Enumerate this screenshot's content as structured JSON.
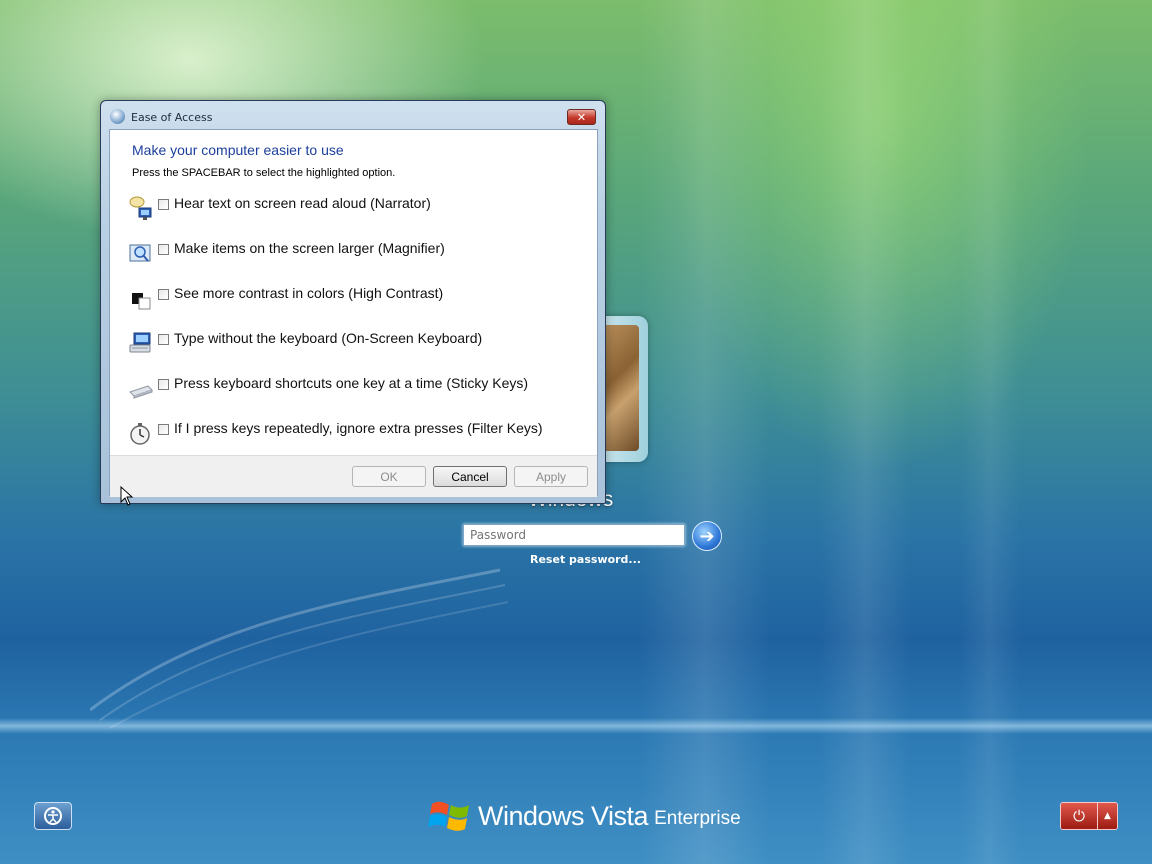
{
  "dialog": {
    "title": "Ease of Access",
    "heading": "Make your computer easier to use",
    "subtext": "Press the SPACEBAR to select the highlighted option.",
    "options": [
      {
        "label": "Hear text on screen read aloud (Narrator)",
        "icon": "narrator-icon",
        "checked": false
      },
      {
        "label": "Make items on the screen larger (Magnifier)",
        "icon": "magnifier-icon",
        "checked": false
      },
      {
        "label": "See more contrast in colors (High Contrast)",
        "icon": "high-contrast-icon",
        "checked": false
      },
      {
        "label": "Type without the keyboard (On-Screen Keyboard)",
        "icon": "on-screen-keyboard-icon",
        "checked": false
      },
      {
        "label": "Press keyboard shortcuts one key at a time (Sticky Keys)",
        "icon": "sticky-keys-icon",
        "checked": false
      },
      {
        "label": "If I press keys repeatedly, ignore extra presses (Filter Keys)",
        "icon": "filter-keys-icon",
        "checked": false
      }
    ],
    "buttons": {
      "ok": "OK",
      "cancel": "Cancel",
      "apply": "Apply"
    }
  },
  "login": {
    "user_name": "Windows",
    "password_placeholder": "Password",
    "reset_link": "Reset password..."
  },
  "branding": {
    "product": "Windows Vista",
    "edition": "Enterprise"
  },
  "colors": {
    "heading": "#1d3f9c",
    "power_button": "#c4392b",
    "close_button": "#c4392b"
  }
}
